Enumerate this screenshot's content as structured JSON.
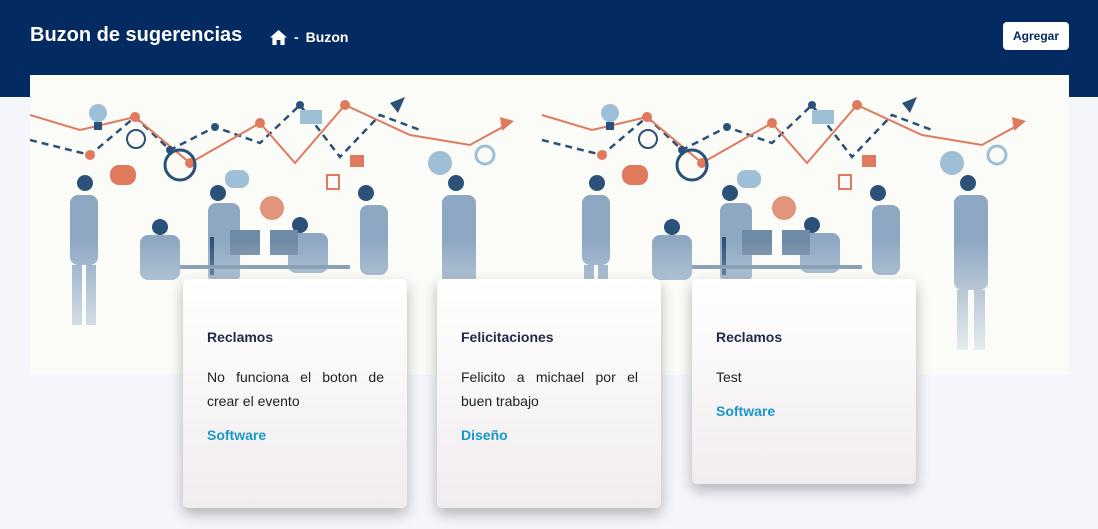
{
  "header": {
    "title": "Buzon de sugerencias",
    "breadcrumb": {
      "home_icon": "home-icon",
      "separator": "-",
      "current": "Buzon"
    },
    "add_label": "Agregar"
  },
  "colors": {
    "header_bg": "#032a61",
    "tag": "#1798c9",
    "page_bg": "#f4f6fb"
  },
  "cards": [
    {
      "title": "Reclamos",
      "text": "No funciona el boton de crear el evento",
      "tag": "Software"
    },
    {
      "title": "Felicitaciones",
      "text": "Felicito a michael por el buen trabajo",
      "tag": "Diseño"
    },
    {
      "title": "Reclamos",
      "text": "Test",
      "tag": "Software"
    }
  ]
}
